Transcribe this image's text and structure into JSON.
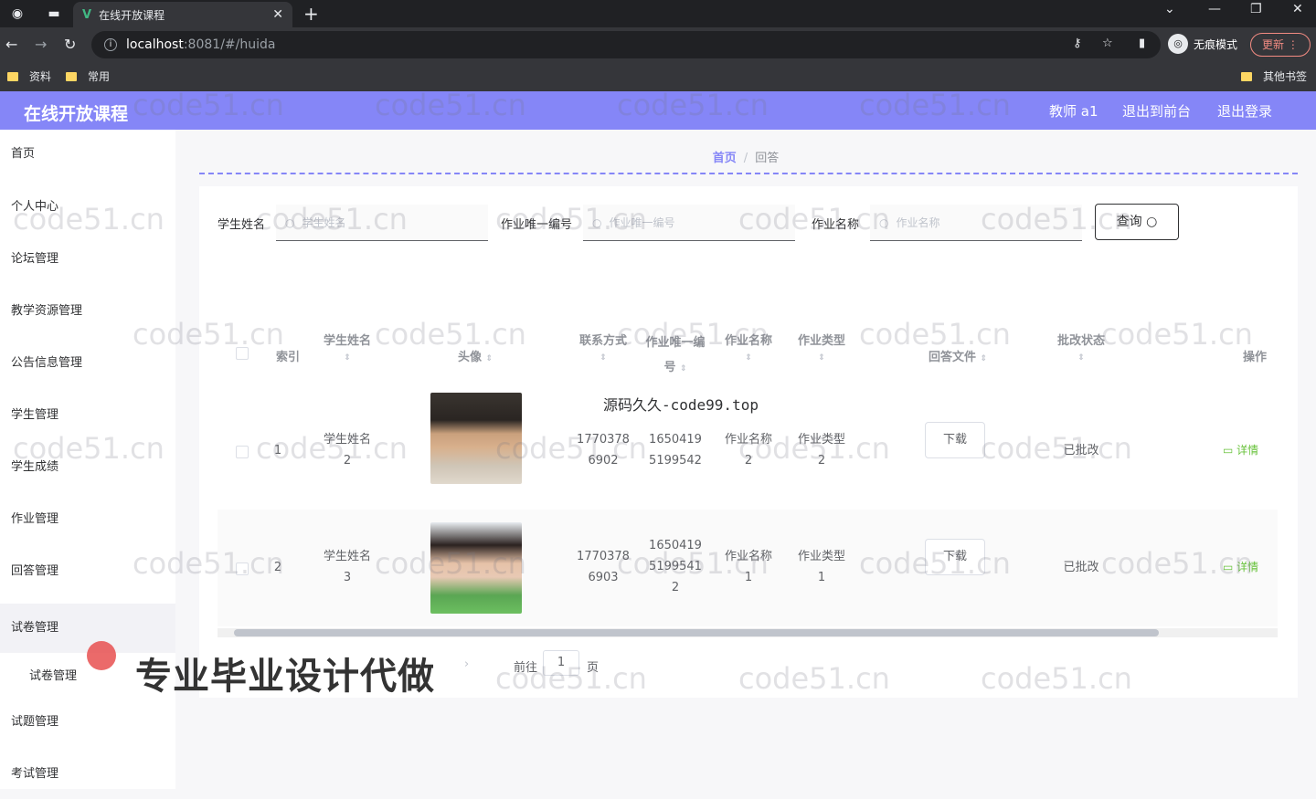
{
  "browser": {
    "tab_title": "在线开放课程",
    "url_host": "localhost",
    "url_path": ":8081/#/huida",
    "incognito_label": "无痕模式",
    "update_label": "更新",
    "bookmarks": [
      "资料",
      "常用"
    ],
    "other_bookmarks": "其他书签"
  },
  "header": {
    "brand": "在线开放课程",
    "user": "教师 a1",
    "front_link": "退出到前台",
    "logout_link": "退出登录",
    "accent_color": "#8586f7"
  },
  "sidebar": {
    "items": [
      "首页",
      "个人中心",
      "论坛管理",
      "教学资源管理",
      "公告信息管理",
      "学生管理",
      "学生成绩",
      "作业管理",
      "回答管理",
      "试卷管理",
      "试卷管理",
      "试题管理",
      "考试管理"
    ]
  },
  "breadcrumb": {
    "home": "首页",
    "current": "回答"
  },
  "search": {
    "student_label": "学生姓名",
    "student_placeholder": "学生姓名",
    "hwid_label": "作业唯一编号",
    "hwid_placeholder": "作业唯一编号",
    "hwname_label": "作业名称",
    "hwname_placeholder": "作业名称",
    "query_button": "查询"
  },
  "table": {
    "headers": [
      "索引",
      "学生姓名",
      "头像",
      "联系方式",
      "作业唯一编号",
      "作业名称",
      "作业类型",
      "回答文件",
      "批改状态",
      "操作"
    ],
    "rows": [
      {
        "index": "1",
        "student": "学生姓名2",
        "phone": "17703786902",
        "hwid": "16504195199542",
        "hwname": "作业名称2",
        "hwtype": "作业类型2",
        "file_btn": "下载",
        "status": "已批改",
        "action": "详情"
      },
      {
        "index": "2",
        "student": "学生姓名3",
        "phone": "17703786903",
        "hwid": "165041951995412",
        "hwname": "作业名称1",
        "hwtype": "作业类型1",
        "file_btn": "下载",
        "status": "已批改",
        "action": "详情"
      }
    ]
  },
  "pagination": {
    "goto_label": "前往",
    "page_value": "1",
    "page_unit": "页"
  },
  "source_note": "源码久久-code99.top",
  "watermark": "code51.cn",
  "overlay_text": "专业毕业设计代做"
}
